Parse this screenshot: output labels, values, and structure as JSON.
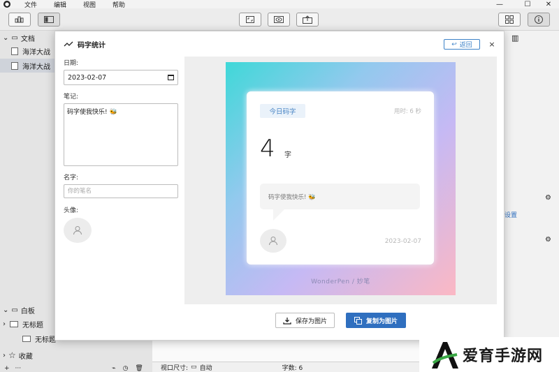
{
  "menu": {
    "file": "文件",
    "edit": "编辑",
    "view": "视图",
    "help": "帮助"
  },
  "sidebar": {
    "docs_section": "文档",
    "docs": [
      "海洋大战",
      "海洋大战"
    ],
    "whiteboard_section": "白板",
    "whiteboard_item": "无标题",
    "whiteboard_sub": "无标题",
    "favorites": "收藏"
  },
  "statusbar": {
    "viewport_label": "视口尺寸:",
    "viewport_value": "自动",
    "word_count": "字数: 6"
  },
  "right_panel": {
    "settings_fragment": "设置"
  },
  "modal": {
    "title": "码字统计",
    "back_label": "返回",
    "close_glyph": "×",
    "date_label": "日期:",
    "date_value": "2023-02-07",
    "note_label": "笔记:",
    "note_value": "码字使我快乐! 🐝",
    "name_label": "名字:",
    "name_placeholder": "你的笔名",
    "avatar_label": "头像:",
    "save_label": "保存为图片",
    "copy_label": "复制为图片"
  },
  "card": {
    "today_tag": "今日码字",
    "elapsed": "用时: 6 秒",
    "count": "4",
    "unit": "字",
    "note": "码字使我快乐! 🐝",
    "date": "2023-02-07",
    "brand": "WonderPen / 妙笔"
  },
  "watermark": {
    "text": "爱育手游网",
    "letter": "A"
  },
  "colors": {
    "accent": "#2f6fbf",
    "tag_bg": "#eaf2fa",
    "tag_text": "#4884c4"
  }
}
